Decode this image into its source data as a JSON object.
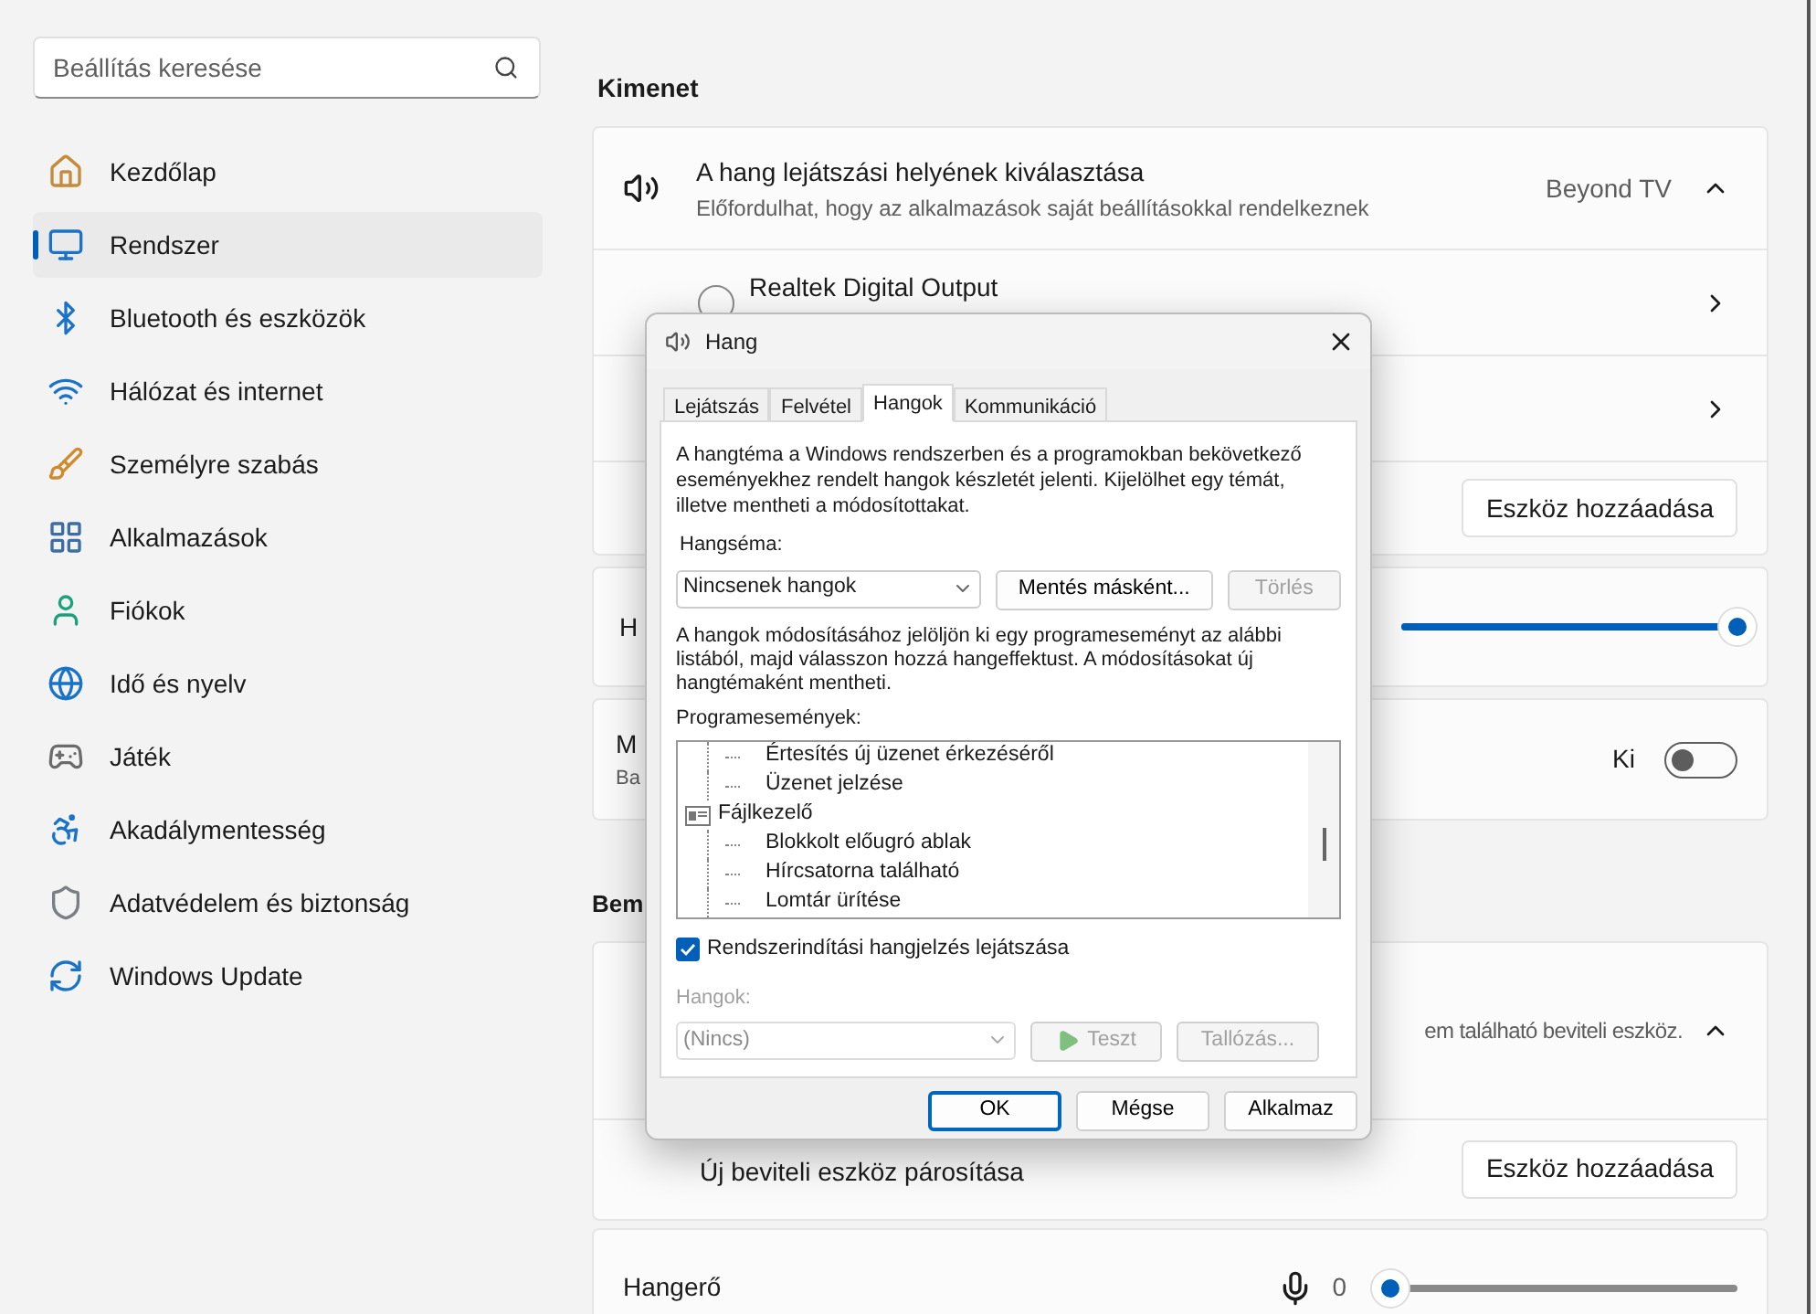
{
  "sidebar": {
    "search": {
      "placeholder": "Beállítás keresése"
    },
    "items": [
      {
        "label": "Kezdőlap",
        "selected": false
      },
      {
        "label": "Rendszer",
        "selected": true
      },
      {
        "label": "Bluetooth és eszközök",
        "selected": false
      },
      {
        "label": "Hálózat és internet",
        "selected": false
      },
      {
        "label": "Személyre szabás",
        "selected": false
      },
      {
        "label": "Alkalmazások",
        "selected": false
      },
      {
        "label": "Fiókok",
        "selected": false
      },
      {
        "label": "Idő és nyelv",
        "selected": false
      },
      {
        "label": "Játék",
        "selected": false
      },
      {
        "label": "Akadálymentesség",
        "selected": false
      },
      {
        "label": "Adatvédelem és biztonság",
        "selected": false
      },
      {
        "label": "Windows Update",
        "selected": false
      }
    ]
  },
  "output": {
    "heading": "Kimenet",
    "choose": {
      "title": "A hang lejátszási helyének kiválasztása",
      "subtitle": "Előfordulhat, hogy az alkalmazások saját beállításokkal rendelkeznek",
      "value": "Beyond TV",
      "expanded": true
    },
    "devices": [
      {
        "name": "Realtek Digital Output",
        "selected": false
      }
    ],
    "add": {
      "button": "Eszköz hozzáadása"
    },
    "volume": {
      "label": "H",
      "level": 1
    },
    "mono": {
      "label": "M",
      "sublabel": "Ba",
      "state_text": "Ki",
      "on": false
    }
  },
  "input": {
    "heading": "Bem",
    "choose": {
      "value": "em található beviteli eszköz.",
      "expanded": true
    },
    "pair": {
      "label": "Új beviteli eszköz párosítása",
      "button": "Eszköz hozzáadása"
    },
    "volume": {
      "label": "Hangerő",
      "reading": "0",
      "level": 0
    }
  },
  "dialog": {
    "title": "Hang",
    "tabs": [
      {
        "label": "Lejátszás",
        "selected": false
      },
      {
        "label": "Felvétel",
        "selected": false
      },
      {
        "label": "Hangok",
        "selected": true
      },
      {
        "label": "Kommunikáció",
        "selected": false
      }
    ],
    "intro": "A hangtéma a Windows rendszerben és a programokban bekövetkező eseményekhez rendelt hangok készletét jelenti. Kijelölhet egy témát, illetve mentheti a módosítottakat.",
    "scheme_label": "Hangséma:",
    "scheme": {
      "value": "Nincsenek hangok"
    },
    "save_as": {
      "label": "Mentés másként...",
      "disabled": false
    },
    "delete": {
      "label": "Törlés",
      "disabled": true
    },
    "hint": "A hangok módosításához jelöljön ki egy programeseményt az alábbi listából, majd válasszon hozzá hangeffektust. A módosításokat új hangtémaként mentheti.",
    "events_label": "Programesemények:",
    "events": [
      {
        "kind": "continued",
        "children": [
          {
            "label": "Értesítés új üzenet érkezéséről"
          },
          {
            "label": "Üzenet jelzése"
          }
        ]
      },
      {
        "kind": "group",
        "label": "Fájlkezelő",
        "children": [
          {
            "label": "Blokkolt előugró ablak"
          },
          {
            "label": "Hírcsatorna található"
          },
          {
            "label": "Lomtár ürítése"
          }
        ]
      }
    ],
    "startup": {
      "label": "Rendszerindítási hangjelzés lejátszása",
      "checked": true
    },
    "sounds_label": "Hangok:",
    "sound": {
      "value": "(Nincs)",
      "disabled": true
    },
    "test": {
      "label": "Teszt",
      "disabled": true
    },
    "browse": {
      "label": "Tallózás...",
      "disabled": true
    },
    "buttons": [
      {
        "label": "OK",
        "kind": "default"
      },
      {
        "label": "Mégse",
        "kind": "normal"
      },
      {
        "label": "Alkalmaz",
        "kind": "normal"
      }
    ]
  }
}
